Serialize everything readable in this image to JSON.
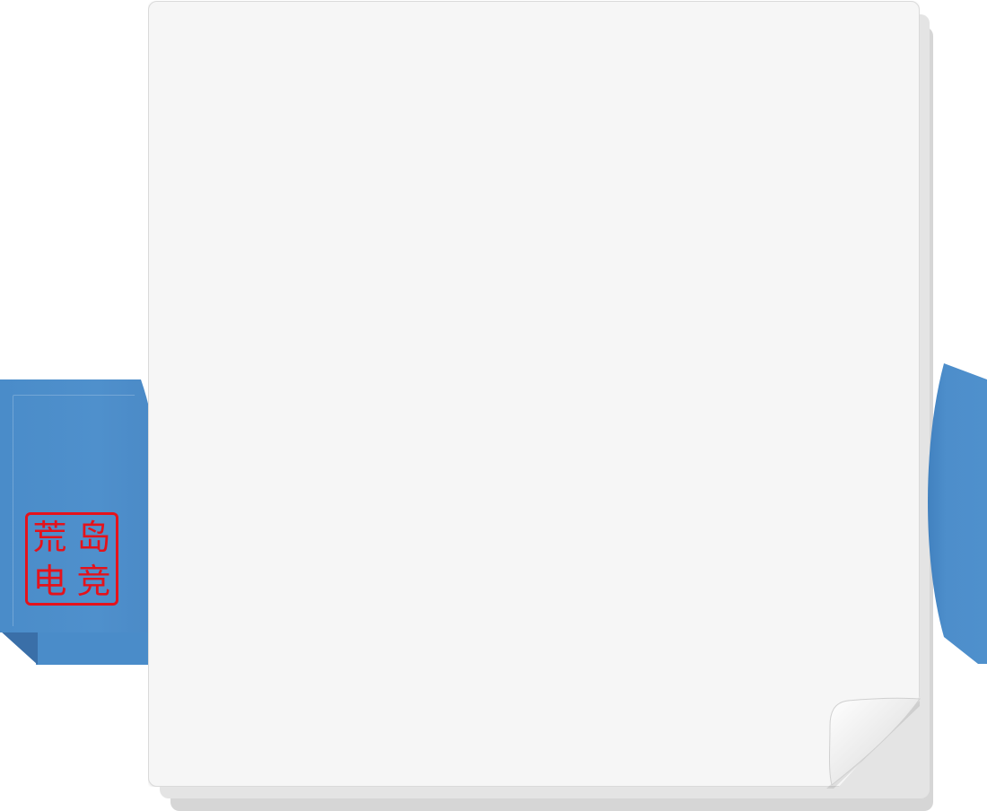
{
  "scene": {
    "title": "",
    "paper_color": "#f6f6f6",
    "tab_color": "#4f90cc",
    "tab_fold_color": "#3a6fa8",
    "seal_color": "#e5121b"
  },
  "seal": {
    "char_top_left": "荒",
    "char_top_right": "岛",
    "char_bottom_left": "电",
    "char_bottom_right": "竞"
  },
  "icons": {
    "page_curl": "page-curl-icon"
  }
}
